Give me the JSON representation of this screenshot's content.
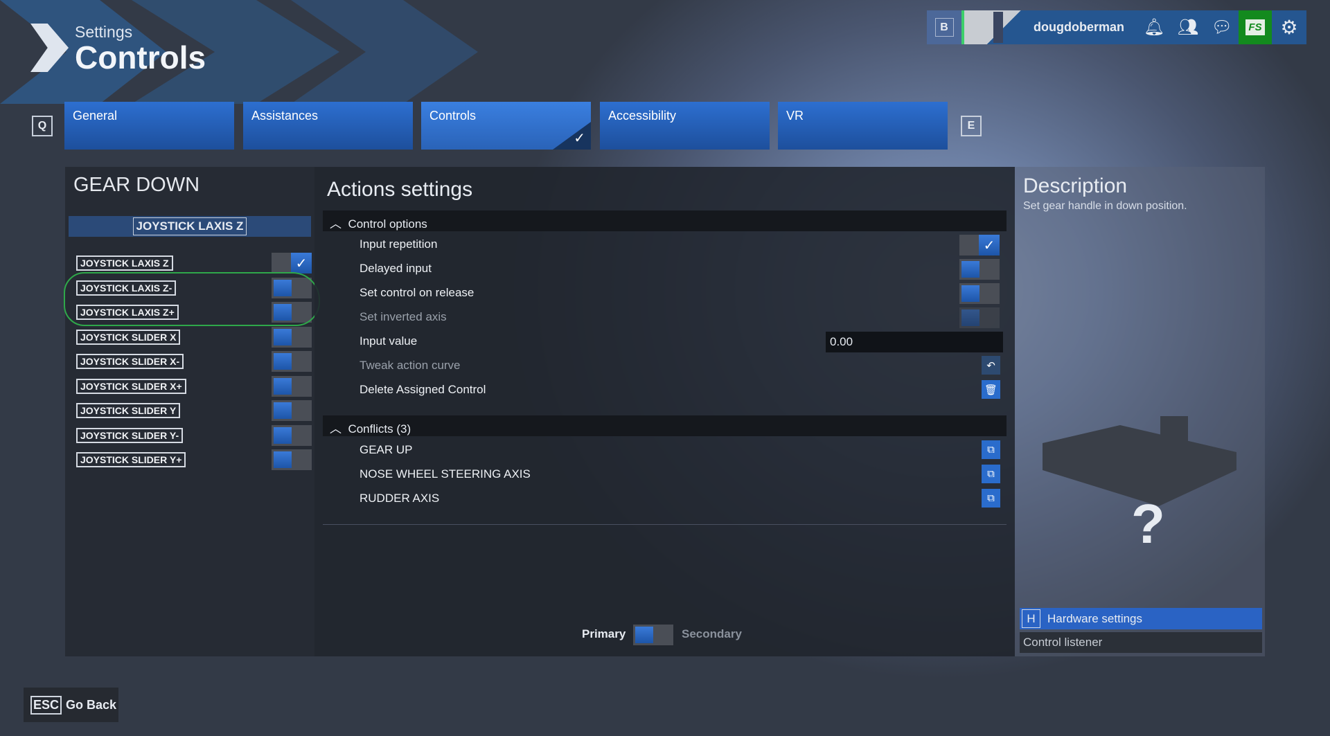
{
  "header": {
    "subtitle": "Settings",
    "title": "Controls"
  },
  "topbar": {
    "b_key": "B",
    "username": "dougdoberman",
    "icons": [
      "bell-icon",
      "friends-icon",
      "chat-icon",
      "marketplace-icon",
      "gear-icon"
    ],
    "marketplace_label": "FS"
  },
  "tabs": {
    "prev_key": "Q",
    "next_key": "E",
    "items": [
      {
        "label": "General"
      },
      {
        "label": "Assistances"
      },
      {
        "label": "Controls",
        "active": true
      },
      {
        "label": "Accessibility"
      },
      {
        "label": "VR"
      }
    ]
  },
  "left": {
    "title": "GEAR DOWN",
    "selected": "JOYSTICK LAXIS Z",
    "inputs": [
      {
        "label": "JOYSTICK LAXIS Z",
        "on": true
      },
      {
        "label": "JOYSTICK LAXIS Z-",
        "on": false
      },
      {
        "label": "JOYSTICK LAXIS Z+",
        "on": false
      },
      {
        "label": "JOYSTICK SLIDER X",
        "on": false
      },
      {
        "label": "JOYSTICK SLIDER X-",
        "on": false
      },
      {
        "label": "JOYSTICK SLIDER X+",
        "on": false
      },
      {
        "label": "JOYSTICK SLIDER Y",
        "on": false
      },
      {
        "label": "JOYSTICK SLIDER Y-",
        "on": false
      },
      {
        "label": "JOYSTICK SLIDER Y+",
        "on": false
      }
    ]
  },
  "actions": {
    "title": "Actions settings",
    "control_options": "Control options",
    "options": {
      "input_repetition": "Input repetition",
      "delayed_input": "Delayed input",
      "set_on_release": "Set control on release",
      "inverted": "Set inverted axis",
      "input_value": "Input value",
      "input_value_val": "0.00",
      "tweak": "Tweak action curve",
      "delete": "Delete Assigned Control"
    },
    "conflicts_header": "Conflicts (3)",
    "conflicts": [
      "GEAR UP",
      "NOSE WHEEL STEERING AXIS",
      "RUDDER AXIS"
    ],
    "primary": "Primary",
    "secondary": "Secondary"
  },
  "description": {
    "title": "Description",
    "text": "Set gear handle in down position.",
    "hardware_key": "H",
    "hardware": "Hardware settings",
    "listener": "Control listener",
    "unknown_mark": "?"
  },
  "footer": {
    "esc_key": "ESC",
    "back": "Go Back"
  }
}
